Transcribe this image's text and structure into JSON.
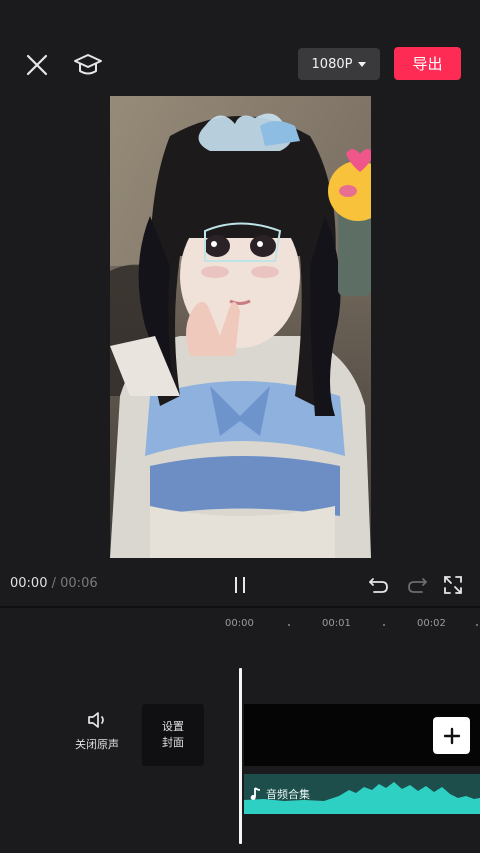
{
  "header": {
    "resolution_label": "1080P",
    "export_label": "导出",
    "icons": {
      "close": "close-icon",
      "tutorial": "graduation-cap-icon",
      "resolution_caret": "caret-down-icon"
    }
  },
  "preview": {
    "content": "selfie-photo"
  },
  "playback": {
    "current_time": "00:00",
    "separator": "/",
    "total_time": "00:06",
    "icons": {
      "play_pause": "pause-icon",
      "undo": "undo-icon",
      "redo": "redo-icon",
      "fullscreen": "fullscreen-icon"
    }
  },
  "timeline": {
    "ruler_labels": [
      "00:00",
      "00:01",
      "00:02"
    ],
    "mute": {
      "label": "关闭原声",
      "icon": "speaker-icon"
    },
    "cover": {
      "line1": "设置",
      "line2": "封面"
    },
    "add_icon": "plus-icon",
    "audio": {
      "label": "音频合集",
      "icon": "music-note-icon"
    }
  },
  "colors": {
    "accent": "#fe2c55",
    "background": "#1b1b1d",
    "audio_wave": "#2fd0c4",
    "audio_track": "#1e4e4b"
  }
}
